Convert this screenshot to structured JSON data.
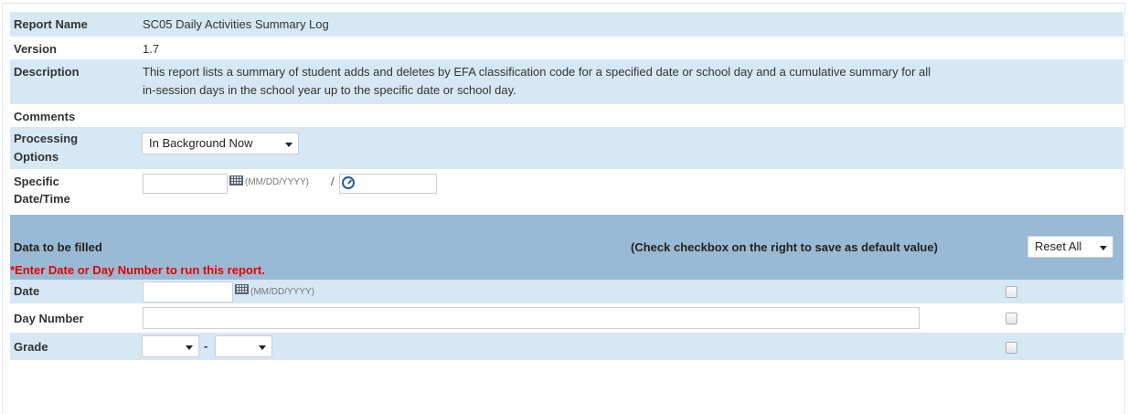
{
  "report": {
    "name_label": "Report Name",
    "name_value": "SC05 Daily Activities Summary Log",
    "version_label": "Version",
    "version_value": "1.7",
    "description_label": "Description",
    "description_line1": "This report lists a summary of student adds and deletes by EFA classification code for a specified date or school day and a cumulative summary for all",
    "description_line2": "in-session days in the school year up to the specific date or school day.",
    "comments_label": "Comments",
    "processing_label_line1": "Processing",
    "processing_label_line2": "Options",
    "processing_selected": "In Background Now",
    "specific_label_line1": "Specific",
    "specific_label_line2": "Date/Time",
    "date_format_hint": "(MM/DD/YYYY)",
    "date_time_separator": "/",
    "specific_date_value": "",
    "specific_time_value": ""
  },
  "data_section": {
    "title": "Data to be filled",
    "default_note": "(Check checkbox on the right to save as default value)",
    "reset_selected": "Reset All",
    "warning": "*Enter Date or Day Number to run this report.",
    "warning_color": "#e60000"
  },
  "params": {
    "date_label": "Date",
    "date_value": "",
    "date_hint": "(MM/DD/YYYY)",
    "day_number_label": "Day Number",
    "day_number_value": "",
    "grade_label": "Grade",
    "grade_from": "",
    "grade_separator": "-",
    "grade_to": ""
  },
  "colors": {
    "row_blue": "#d6e8f3",
    "section_header": "#9ab9d4",
    "icon_blue": "#1f5e99"
  }
}
